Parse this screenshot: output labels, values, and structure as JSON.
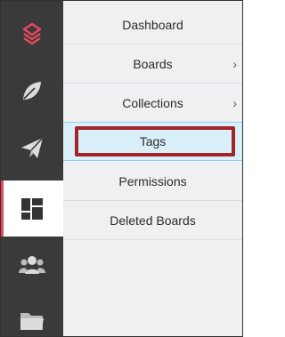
{
  "sidebar": {
    "items": [
      {
        "icon": "logo-icon",
        "color": "#e8475f"
      },
      {
        "icon": "leaf-icon"
      },
      {
        "icon": "paper-plane-icon"
      },
      {
        "icon": "dashboard-grid-icon",
        "active": true
      },
      {
        "icon": "users-group-icon"
      },
      {
        "icon": "folder-icon"
      }
    ]
  },
  "menu": {
    "items": [
      {
        "label": "Dashboard"
      },
      {
        "label": "Boards",
        "chevron": "›"
      },
      {
        "label": "Collections",
        "chevron": "›"
      },
      {
        "label": "Tags",
        "selected": true
      },
      {
        "label": "Permissions"
      },
      {
        "label": "Deleted Boards"
      }
    ]
  },
  "colors": {
    "rail_bg": "#3a3a3a",
    "brand": "#e8475f",
    "selected_bg": "#d9f0fb",
    "highlight_border": "#a3252a"
  }
}
